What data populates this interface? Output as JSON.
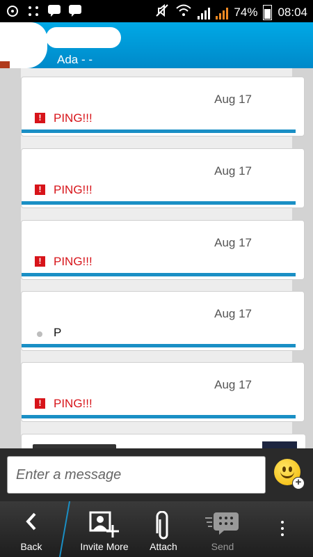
{
  "status_bar": {
    "battery": "74%",
    "time": "08:04",
    "icons": [
      "notification-icon",
      "apps-icon",
      "bbm-icon",
      "bbm-alt-icon",
      "mute-icon",
      "wifi-icon",
      "signal-icon",
      "roaming-signal-icon",
      "battery-icon"
    ]
  },
  "header": {
    "subtitle": "Ada - -"
  },
  "messages": [
    {
      "date": "Aug 17",
      "text": "PING!!!",
      "type": "ping"
    },
    {
      "date": "Aug 17",
      "text": "PING!!!",
      "type": "ping"
    },
    {
      "date": "Aug 17",
      "text": "PING!!!",
      "type": "ping"
    },
    {
      "date": "Aug 17",
      "text": "P",
      "type": "plain"
    },
    {
      "date": "Aug 17",
      "text": "PING!!!",
      "type": "ping"
    }
  ],
  "composer": {
    "placeholder": "Enter a message"
  },
  "toolbar": {
    "back": "Back",
    "invite_more": "Invite More",
    "attach": "Attach",
    "send": "Send"
  },
  "colors": {
    "header_blue": "#00a9e6",
    "ping_red": "#d7141a",
    "bubble_accent": "#1a8fc5"
  }
}
